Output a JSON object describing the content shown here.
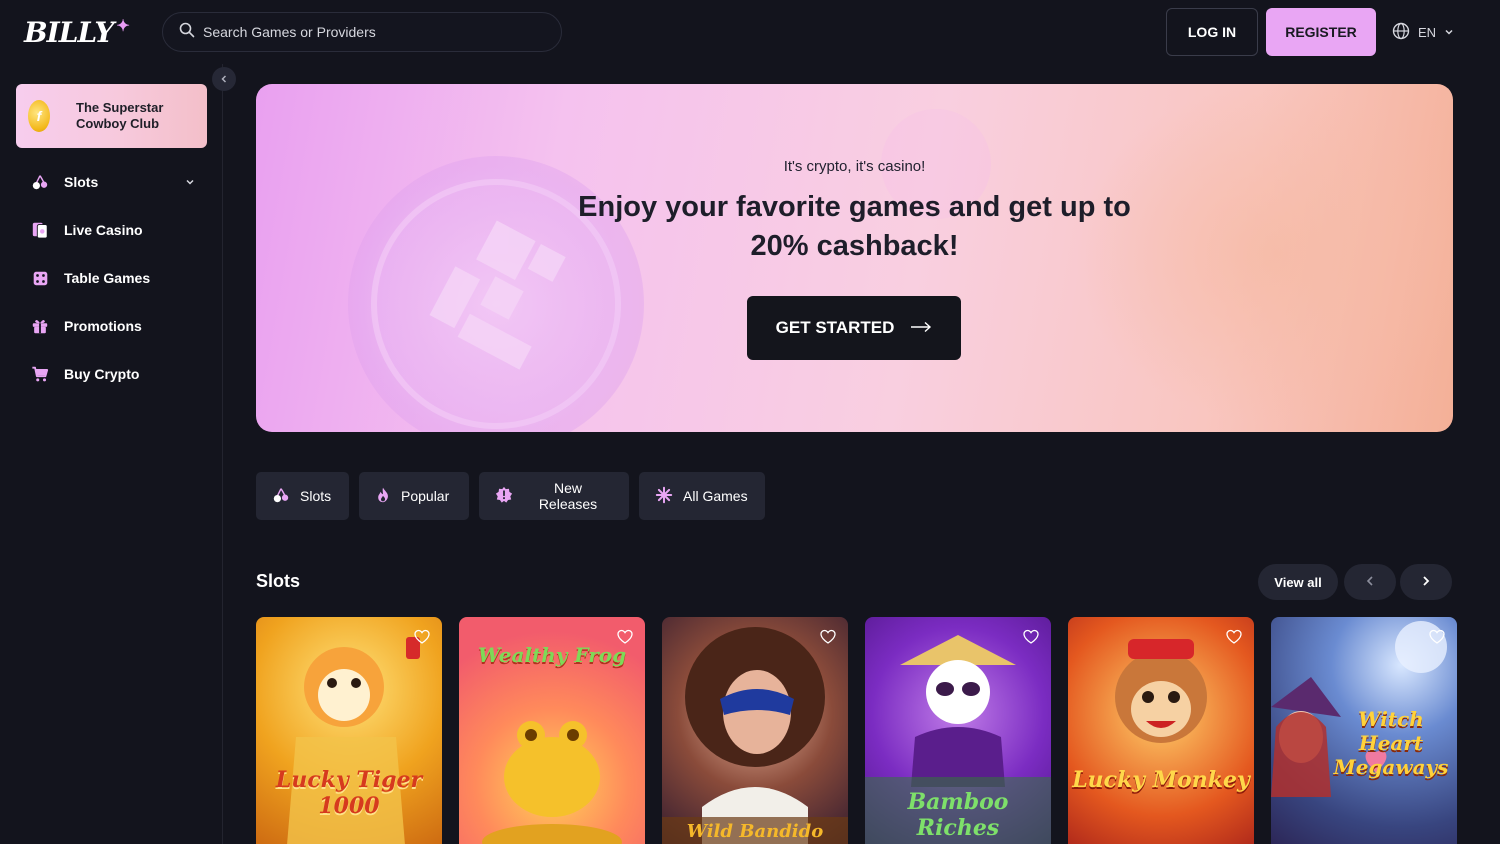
{
  "header": {
    "logo_text": "BILLY",
    "logo_spark": "✦",
    "search_placeholder": "Search Games or Providers",
    "login_label": "LOG IN",
    "register_label": "REGISTER",
    "language": "EN"
  },
  "sidebar": {
    "promo": {
      "text": "The Superstar Cowboy Club"
    },
    "items": [
      {
        "label": "Slots",
        "icon": "cherries-icon",
        "has_chevron": true
      },
      {
        "label": "Live Casino",
        "icon": "live-cards-icon"
      },
      {
        "label": "Table Games",
        "icon": "dice-icon"
      },
      {
        "label": "Promotions",
        "icon": "gift-icon"
      },
      {
        "label": "Buy Crypto",
        "icon": "cart-icon"
      }
    ]
  },
  "hero": {
    "subtitle": "It's crypto, it's casino!",
    "title": "Enjoy your favorite games and get up to 20% cashback!",
    "cta_label": "GET STARTED"
  },
  "tabs": [
    {
      "label": "Slots",
      "icon": "cherries-icon"
    },
    {
      "label": "Popular",
      "icon": "flame-icon"
    },
    {
      "label": "New Releases",
      "icon": "new-badge-icon"
    },
    {
      "label": "All Games",
      "icon": "sparkle-icon"
    }
  ],
  "slots_section": {
    "title": "Slots",
    "view_all_label": "View all"
  },
  "games": [
    {
      "title": "Lucky Tiger 1000"
    },
    {
      "title": "Wealthy Frog"
    },
    {
      "title": "Wild Bandido"
    },
    {
      "title": "Bamboo Riches"
    },
    {
      "title": "Lucky Monkey"
    },
    {
      "title": "Witch Heart Megaways"
    }
  ],
  "colors": {
    "background": "#13141d",
    "accent": "#e9a6f4",
    "tab_bg": "#242633",
    "hero_cta_bg": "#14151c"
  }
}
